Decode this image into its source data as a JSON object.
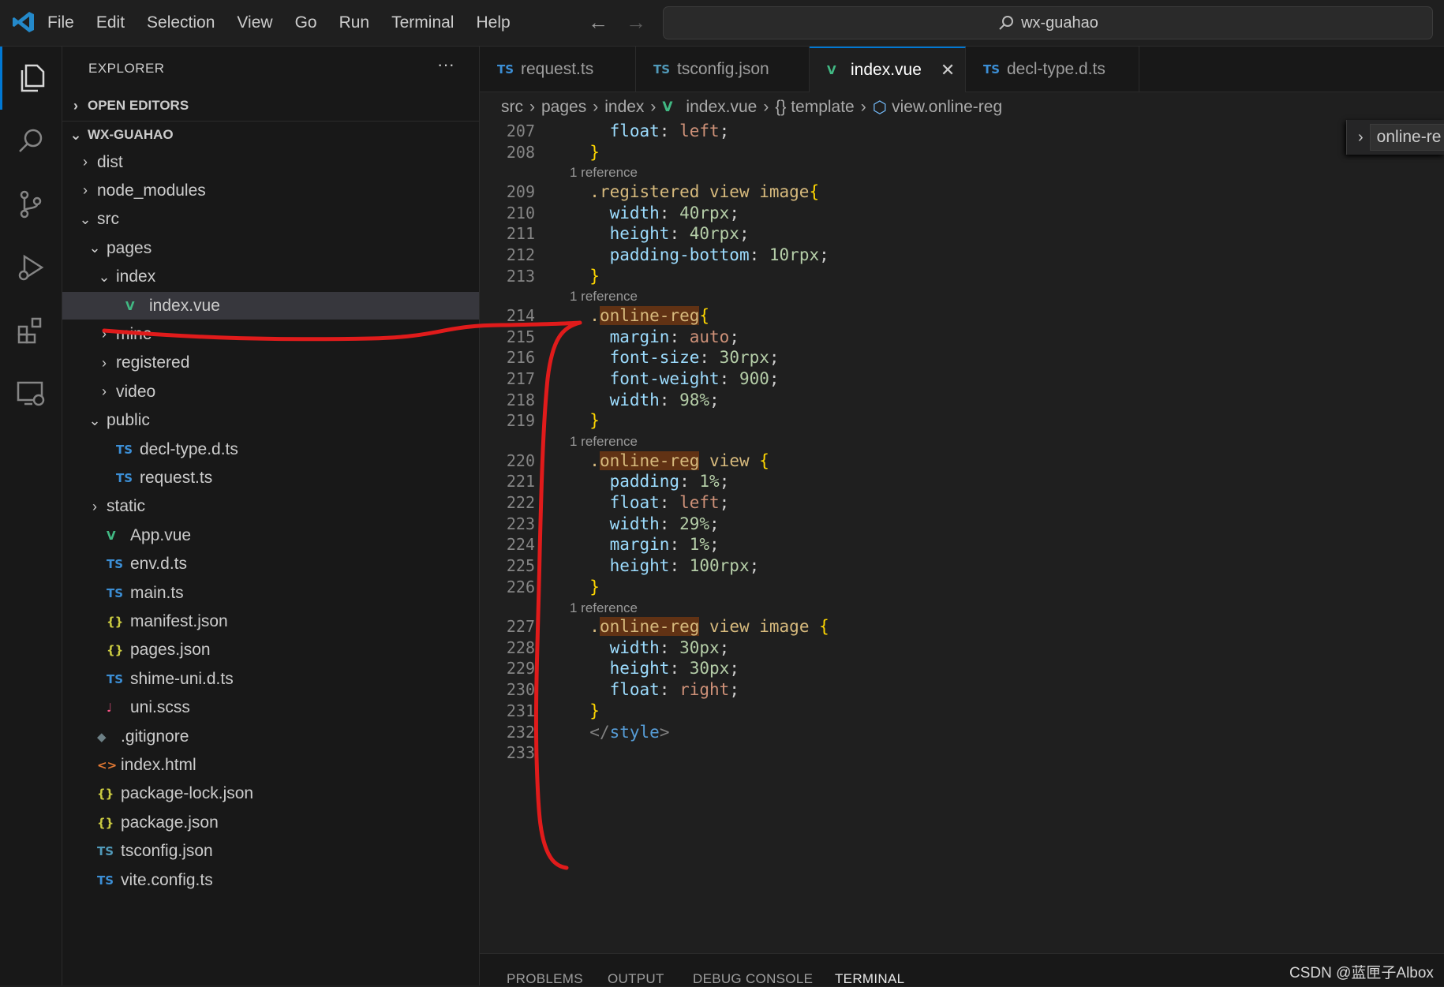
{
  "menu": [
    "File",
    "Edit",
    "Selection",
    "View",
    "Go",
    "Run",
    "Terminal",
    "Help"
  ],
  "search": {
    "text": "wx-guahao"
  },
  "explorer": {
    "title": "EXPLORER",
    "more": "···",
    "open_editors": "OPEN EDITORS",
    "project": "WX-GUAHAO",
    "tree": [
      {
        "label": "dist",
        "chev": "›",
        "icon": "",
        "cls": ""
      },
      {
        "label": "node_modules",
        "chev": "›",
        "icon": "",
        "cls": ""
      },
      {
        "label": "src",
        "chev": "⌄",
        "icon": "",
        "cls": ""
      },
      {
        "label": "pages",
        "chev": "⌄",
        "icon": "",
        "cls": ""
      },
      {
        "label": "index",
        "chev": "⌄",
        "icon": "",
        "cls": ""
      },
      {
        "label": "index.vue",
        "chev": "",
        "icon": "V",
        "cls": "vue"
      },
      {
        "label": "mine",
        "chev": "›",
        "icon": "",
        "cls": ""
      },
      {
        "label": "registered",
        "chev": "›",
        "icon": "",
        "cls": ""
      },
      {
        "label": "video",
        "chev": "›",
        "icon": "",
        "cls": ""
      },
      {
        "label": "public",
        "chev": "⌄",
        "icon": "",
        "cls": ""
      },
      {
        "label": "decl-type.d.ts",
        "chev": "",
        "icon": "TS",
        "cls": "ts"
      },
      {
        "label": "request.ts",
        "chev": "",
        "icon": "TS",
        "cls": "ts"
      },
      {
        "label": "static",
        "chev": "›",
        "icon": "",
        "cls": ""
      },
      {
        "label": "App.vue",
        "chev": "",
        "icon": "V",
        "cls": "vue"
      },
      {
        "label": "env.d.ts",
        "chev": "",
        "icon": "TS",
        "cls": "ts"
      },
      {
        "label": "main.ts",
        "chev": "",
        "icon": "TS",
        "cls": "ts"
      },
      {
        "label": "manifest.json",
        "chev": "",
        "icon": "{}",
        "cls": "json"
      },
      {
        "label": "pages.json",
        "chev": "",
        "icon": "{}",
        "cls": "json"
      },
      {
        "label": "shime-uni.d.ts",
        "chev": "",
        "icon": "TS",
        "cls": "ts"
      },
      {
        "label": "uni.scss",
        "chev": "",
        "icon": "♩",
        "cls": "scss"
      },
      {
        "label": ".gitignore",
        "chev": "",
        "icon": "◆",
        "cls": "git"
      },
      {
        "label": "index.html",
        "chev": "",
        "icon": "<>",
        "cls": "html"
      },
      {
        "label": "package-lock.json",
        "chev": "",
        "icon": "{}",
        "cls": "json"
      },
      {
        "label": "package.json",
        "chev": "",
        "icon": "{}",
        "cls": "json"
      },
      {
        "label": "tsconfig.json",
        "chev": "",
        "icon": "TS",
        "cls": "tsc"
      },
      {
        "label": "vite.config.ts",
        "chev": "",
        "icon": "TS",
        "cls": "ts"
      }
    ]
  },
  "tabs": [
    {
      "label": "request.ts",
      "icon": "TS",
      "cls": "ts"
    },
    {
      "label": "tsconfig.json",
      "icon": "TS",
      "cls": "tsc"
    },
    {
      "label": "index.vue",
      "icon": "V",
      "cls": "vue",
      "active": true,
      "close": "✕"
    },
    {
      "label": "decl-type.d.ts",
      "icon": "TS",
      "cls": "ts"
    }
  ],
  "breadcrumb": [
    "src",
    "pages",
    "index",
    "index.vue",
    "{} template",
    "view.online-reg"
  ],
  "sticky": {
    "label": "online-re"
  },
  "editor": {
    "reference_text": "1 reference",
    "lines": [
      {
        "n": "207",
        "t": [
          [
            "    ",
            ""
          ],
          [
            "float",
            "tok-prop"
          ],
          [
            ": ",
            ""
          ],
          [
            "left",
            "tok-kw"
          ],
          [
            ";",
            ""
          ]
        ]
      },
      {
        "n": "208",
        "t": [
          [
            "  ",
            ""
          ],
          [
            "}",
            "tok-brace"
          ]
        ]
      },
      {
        "ref": true
      },
      {
        "n": "209",
        "t": [
          [
            "  ",
            ""
          ],
          [
            ".registered view image",
            "tok-sel"
          ],
          [
            "{",
            "tok-brace"
          ]
        ]
      },
      {
        "n": "210",
        "t": [
          [
            "    ",
            ""
          ],
          [
            "width",
            "tok-prop"
          ],
          [
            ": ",
            ""
          ],
          [
            "40rpx",
            "tok-num"
          ],
          [
            ";",
            ""
          ]
        ]
      },
      {
        "n": "211",
        "t": [
          [
            "    ",
            ""
          ],
          [
            "height",
            "tok-prop"
          ],
          [
            ": ",
            ""
          ],
          [
            "40rpx",
            "tok-num"
          ],
          [
            ";",
            ""
          ]
        ]
      },
      {
        "n": "212",
        "t": [
          [
            "    ",
            ""
          ],
          [
            "padding-bottom",
            "tok-prop"
          ],
          [
            ": ",
            ""
          ],
          [
            "10rpx",
            "tok-num"
          ],
          [
            ";",
            ""
          ]
        ]
      },
      {
        "n": "213",
        "t": [
          [
            "  ",
            ""
          ],
          [
            "}",
            "tok-brace"
          ]
        ]
      },
      {
        "ref": true
      },
      {
        "n": "214",
        "t": [
          [
            "  ",
            ""
          ],
          [
            ".",
            "tok-sel"
          ],
          [
            "online-reg",
            "tok-sel hl"
          ],
          [
            "{",
            "tok-brace"
          ]
        ]
      },
      {
        "n": "215",
        "t": [
          [
            "    ",
            ""
          ],
          [
            "margin",
            "tok-prop"
          ],
          [
            ": ",
            ""
          ],
          [
            "auto",
            "tok-kw"
          ],
          [
            ";",
            ""
          ]
        ]
      },
      {
        "n": "216",
        "t": [
          [
            "    ",
            ""
          ],
          [
            "font-size",
            "tok-prop"
          ],
          [
            ": ",
            ""
          ],
          [
            "30rpx",
            "tok-num"
          ],
          [
            ";",
            ""
          ]
        ]
      },
      {
        "n": "217",
        "t": [
          [
            "    ",
            ""
          ],
          [
            "font-weight",
            "tok-prop"
          ],
          [
            ": ",
            ""
          ],
          [
            "900",
            "tok-num"
          ],
          [
            ";",
            ""
          ]
        ]
      },
      {
        "n": "218",
        "t": [
          [
            "    ",
            ""
          ],
          [
            "width",
            "tok-prop"
          ],
          [
            ": ",
            ""
          ],
          [
            "98%",
            "tok-num"
          ],
          [
            ";",
            ""
          ]
        ]
      },
      {
        "n": "219",
        "t": [
          [
            "  ",
            ""
          ],
          [
            "}",
            "tok-brace"
          ]
        ]
      },
      {
        "ref": true
      },
      {
        "n": "220",
        "t": [
          [
            "  ",
            ""
          ],
          [
            ".",
            "tok-sel"
          ],
          [
            "online-reg",
            "tok-sel hl"
          ],
          [
            " view ",
            "tok-sel"
          ],
          [
            "{",
            "tok-brace"
          ]
        ]
      },
      {
        "n": "221",
        "t": [
          [
            "    ",
            ""
          ],
          [
            "padding",
            "tok-prop"
          ],
          [
            ": ",
            ""
          ],
          [
            "1%",
            "tok-num"
          ],
          [
            ";",
            ""
          ]
        ]
      },
      {
        "n": "222",
        "t": [
          [
            "    ",
            ""
          ],
          [
            "float",
            "tok-prop"
          ],
          [
            ": ",
            ""
          ],
          [
            "left",
            "tok-kw"
          ],
          [
            ";",
            ""
          ]
        ]
      },
      {
        "n": "223",
        "t": [
          [
            "    ",
            ""
          ],
          [
            "width",
            "tok-prop"
          ],
          [
            ": ",
            ""
          ],
          [
            "29%",
            "tok-num"
          ],
          [
            ";",
            ""
          ]
        ]
      },
      {
        "n": "224",
        "t": [
          [
            "    ",
            ""
          ],
          [
            "margin",
            "tok-prop"
          ],
          [
            ": ",
            ""
          ],
          [
            "1%",
            "tok-num"
          ],
          [
            ";",
            ""
          ]
        ]
      },
      {
        "n": "225",
        "t": [
          [
            "    ",
            ""
          ],
          [
            "height",
            "tok-prop"
          ],
          [
            ": ",
            ""
          ],
          [
            "100rpx",
            "tok-num"
          ],
          [
            ";",
            ""
          ]
        ]
      },
      {
        "n": "226",
        "t": [
          [
            "  ",
            ""
          ],
          [
            "}",
            "tok-brace"
          ]
        ]
      },
      {
        "ref": true
      },
      {
        "n": "227",
        "t": [
          [
            "  ",
            ""
          ],
          [
            ".",
            "tok-sel"
          ],
          [
            "online-reg",
            "tok-sel hl"
          ],
          [
            " view image ",
            "tok-sel"
          ],
          [
            "{",
            "tok-brace"
          ]
        ]
      },
      {
        "n": "228",
        "t": [
          [
            "    ",
            ""
          ],
          [
            "width",
            "tok-prop"
          ],
          [
            ": ",
            ""
          ],
          [
            "30px",
            "tok-num"
          ],
          [
            ";",
            ""
          ]
        ]
      },
      {
        "n": "229",
        "t": [
          [
            "    ",
            ""
          ],
          [
            "height",
            "tok-prop"
          ],
          [
            ": ",
            ""
          ],
          [
            "30px",
            "tok-num"
          ],
          [
            ";",
            ""
          ]
        ]
      },
      {
        "n": "230",
        "t": [
          [
            "    ",
            ""
          ],
          [
            "float",
            "tok-prop"
          ],
          [
            ": ",
            ""
          ],
          [
            "right",
            "tok-kw"
          ],
          [
            ";",
            ""
          ]
        ]
      },
      {
        "n": "231",
        "t": [
          [
            "  ",
            ""
          ],
          [
            "}",
            "tok-brace"
          ]
        ]
      },
      {
        "n": "232",
        "t": [
          [
            "  ",
            ""
          ],
          [
            "</",
            "tok-ang"
          ],
          [
            "style",
            "tok-tag"
          ],
          [
            ">",
            "tok-ang"
          ]
        ]
      },
      {
        "n": "233",
        "t": []
      }
    ]
  },
  "panel": {
    "tabs": [
      "PROBLEMS",
      "OUTPUT",
      "DEBUG CONSOLE",
      "TERMINAL"
    ],
    "active": "TERMINAL"
  },
  "watermark": "CSDN @蓝匣子Albox",
  "colors": {
    "accent": "#0078d4",
    "annotation": "#e01b1b"
  }
}
